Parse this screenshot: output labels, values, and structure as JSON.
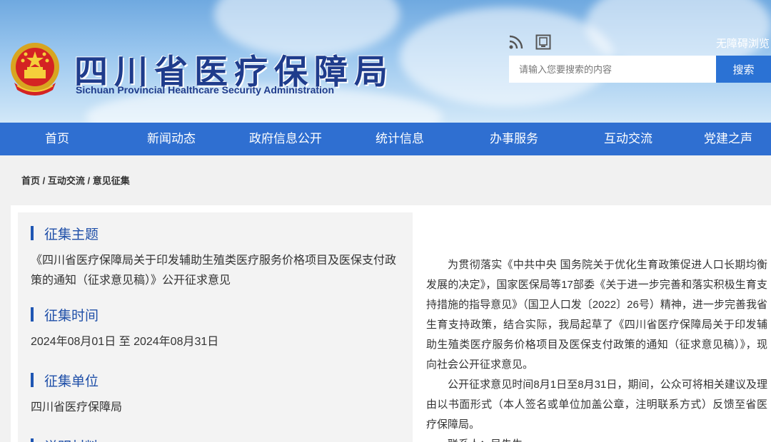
{
  "header": {
    "title_cn": "四川省医疗保障局",
    "title_en": "Sichuan Provincial Healthcare Security Administration",
    "accessibility_label": "无障碍浏览",
    "search_placeholder": "请输入您要搜索的内容",
    "search_button": "搜索",
    "brand_color": "#2f6fd1"
  },
  "nav": {
    "items": [
      "首页",
      "新闻动态",
      "政府信息公开",
      "统计信息",
      "办事服务",
      "互动交流",
      "党建之声"
    ]
  },
  "breadcrumb": {
    "home": "首页",
    "sep1": " / ",
    "section": "互动交流",
    "sep2": " / ",
    "current": "意见征集"
  },
  "left": {
    "topic_title": "征集主题",
    "topic_body": "《四川省医疗保障局关于印发辅助生殖类医疗服务价格项目及医保支付政策的通知（征求意见稿）》公开征求意见",
    "time_title": "征集时间",
    "time_body": "2024年08月01日 至 2024年08月31日",
    "unit_title": "征集单位",
    "unit_body": "四川省医疗保障局",
    "desc_title": "说明材料"
  },
  "right": {
    "para1": "为贯彻落实《中共中央 国务院关于优化生育政策促进人口长期均衡发展的决定》，国家医保局等17部委《关于进一步完善和落实积极生育支持措施的指导意见》（国卫人口发〔2022〕26号）精神，进一步完善我省生育支持政策，结合实际，我局起草了《四川省医疗保障局关于印发辅助生殖类医疗服务价格项目及医保支付政策的通知（征求意见稿）》，现向社会公开征求意见。",
    "para2": "公开征求意见时间8月1日至8月31日，期间，公众可将相关建议及理由以书面形式（本人签名或单位加盖公章，注明联系方式）反馈至省医疗保障局。",
    "para3": "联系人：吴先生"
  }
}
